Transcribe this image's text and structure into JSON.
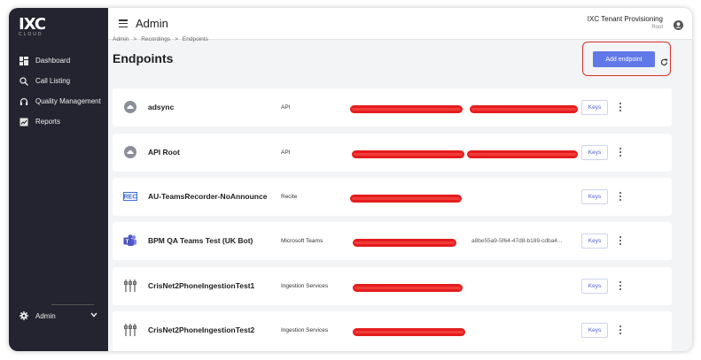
{
  "brand": {
    "logo_text": "IXC",
    "logo_sub": "CLOUD"
  },
  "sidebar": {
    "items": [
      {
        "label": "Dashboard",
        "icon": "dashboard-icon"
      },
      {
        "label": "Call Listing",
        "icon": "search-icon"
      },
      {
        "label": "Quality Management",
        "icon": "headset-icon"
      },
      {
        "label": "Reports",
        "icon": "report-icon"
      }
    ],
    "footer": {
      "label": "Admin",
      "icon": "gear-icon"
    }
  },
  "header": {
    "title": "Admin",
    "tenant_name": "IXC Tenant Provisioning",
    "tenant_role": "Root"
  },
  "breadcrumb": [
    "Admin",
    ">",
    "Recordings",
    ">",
    "Endpoints"
  ],
  "page": {
    "title": "Endpoints",
    "add_button": "Add endpoint"
  },
  "colors": {
    "sidebar": "#23242f",
    "accent": "#6179e8",
    "highlight": "#d9302a",
    "redaction": "#e51d1d"
  },
  "endpoints": [
    {
      "name": "adsync",
      "type": "API",
      "icon": "cloud-icon",
      "id_text": "",
      "keys_label": "Keys"
    },
    {
      "name": "API Root",
      "type": "API",
      "icon": "cloud-icon",
      "id_text": "",
      "keys_label": "Keys"
    },
    {
      "name": "AU-TeamsRecorder-NoAnnounce",
      "type": "Recite",
      "icon": "rec-icon",
      "id_text": "",
      "keys_label": "Keys"
    },
    {
      "name": "BPM QA Teams Test (UK Bot)",
      "type": "Microsoft Teams",
      "icon": "teams-icon",
      "id_text": "a8be55a9-5f64-47d8-b189-cdba4...",
      "keys_label": "Keys"
    },
    {
      "name": "CrisNet2PhoneIngestionTest1",
      "type": "Ingestion Services",
      "icon": "sliders-icon",
      "id_text": "",
      "keys_label": "Keys"
    },
    {
      "name": "CrisNet2PhoneIngestionTest2",
      "type": "Ingestion Services",
      "icon": "sliders-icon",
      "id_text": "",
      "keys_label": "Keys"
    }
  ]
}
